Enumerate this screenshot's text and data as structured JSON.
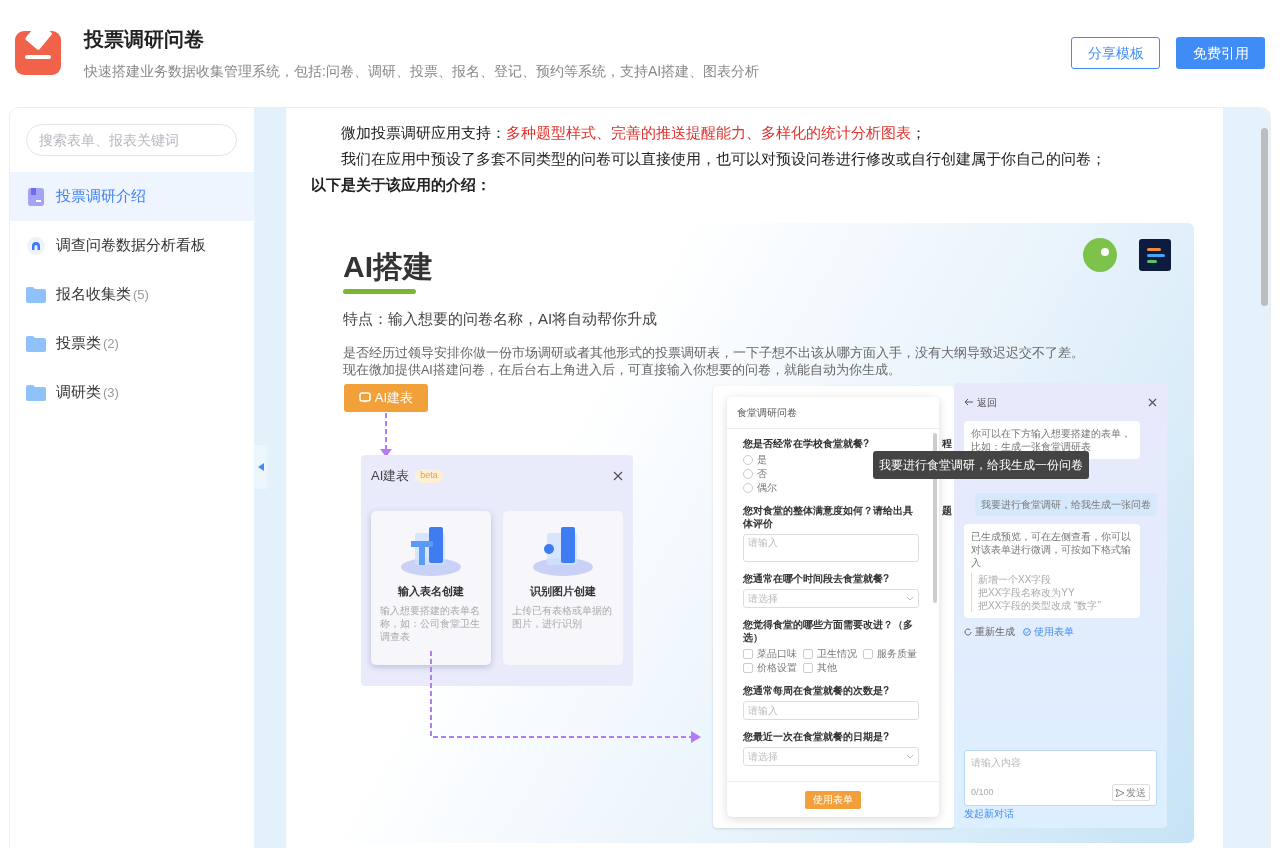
{
  "header": {
    "title": "投票调研问卷",
    "subtitle": "快速搭建业务数据收集管理系统，包括:问卷、调研、投票、报名、登记、预约等系统，支持AI搭建、图表分析",
    "buttons": [
      {
        "label": "分享模板",
        "kind": "outline"
      },
      {
        "label": "免费引用",
        "kind": "primary"
      }
    ]
  },
  "sidebar": {
    "search": {
      "placeholder": "搜索表单、报表关键词"
    },
    "items": [
      {
        "label": "投票调研介绍",
        "kind": "doc",
        "selected": true
      },
      {
        "label": "调查问卷数据分析看板",
        "kind": "dashboard",
        "selected": false
      },
      {
        "label": "报名收集类",
        "count": "(5)",
        "kind": "folder",
        "selected": false
      },
      {
        "label": "投票类",
        "count": "(2)",
        "kind": "folder",
        "selected": false
      },
      {
        "label": "调研类",
        "count": "(3)",
        "kind": "folder",
        "selected": false
      }
    ]
  },
  "content": {
    "paragraphs": [
      {
        "text": "微加投票调研应用支持：",
        "emphasis": "多种题型样式、完善的推送提醒能力、多样化的统计分析图表",
        "tail": "；",
        "indent": true,
        "bold": false
      },
      {
        "text": "我们在应用中预设了多套不同类型的问卷可以直接使用，也可以对预设问卷进行修改或自行创建属于你自己的问卷；",
        "indent": true,
        "bold": false
      },
      {
        "text": "以下是关于该应用的介绍：",
        "indent": false,
        "bold": true
      }
    ],
    "image": {
      "title": "AI搭建",
      "feature": "特点：输入想要的问卷名称，AI将自动帮你升成",
      "description": [
        "是否经历过领导安排你做一份市场调研或者其他形式的投票调研表，一下子想不出该从哪方面入手，没有大纲导致迟迟交不了差。",
        "现在微加提供AI搭建问卷，在后台右上角进入后，可直接输入你想要的问卷，就能自动为你生成。"
      ],
      "ai_button": "AI建表",
      "dialog": {
        "title": "AI建表",
        "badge": "beta",
        "options": [
          {
            "title": "输入表名创建",
            "description": "输入想要搭建的表单名称，如：公司食堂卫生调查表",
            "selected": true
          },
          {
            "title": "识别图片创建",
            "description": "上传已有表格或单据的图片，进行识别",
            "selected": false
          }
        ]
      },
      "background_window": {
        "fragments": [
          "程",
          "题"
        ]
      },
      "form": {
        "title": "食堂调研问卷",
        "questions": [
          {
            "kind": "radio",
            "label": "您是否经常在学校食堂就餐?",
            "options": [
              {
                "label": "是",
                "checked": false
              },
              {
                "label": "否",
                "checked": false
              },
              {
                "label": "偶尔",
                "checked": false
              }
            ]
          },
          {
            "kind": "textarea",
            "label": "您对食堂的整体满意度如何？请给出具体评价",
            "placeholder": "请输入"
          },
          {
            "kind": "select",
            "label": "您通常在哪个时间段去食堂就餐?",
            "placeholder": "请选择"
          },
          {
            "kind": "checkbox",
            "label": "您觉得食堂的哪些方面需要改进？（多选）",
            "options": [
              {
                "label": "菜品口味",
                "checked": false
              },
              {
                "label": "卫生情况",
                "checked": false
              },
              {
                "label": "服务质量",
                "checked": false
              },
              {
                "label": "价格设置",
                "checked": false
              },
              {
                "label": "其他",
                "checked": false
              }
            ]
          },
          {
            "kind": "input",
            "label": "您通常每周在食堂就餐的次数是?",
            "placeholder": "请输入"
          },
          {
            "kind": "select",
            "label": "您最近一次在食堂就餐的日期是?",
            "placeholder": "请选择"
          }
        ],
        "submit": "使用表单"
      },
      "tooltip": "我要进行食堂调研，给我生成一份问卷",
      "chat": {
        "back": "返回",
        "messages": [
          {
            "kind": "assistant",
            "text": "你可以在下方输入想要搭建的表单，比如：生成一张食堂调研表"
          },
          {
            "kind": "user",
            "text": "我要进行食堂调研，给我生成一张问卷"
          },
          {
            "kind": "assistant",
            "text": "已生成预览，可在左侧查看，你可以对该表单进行微调，可按如下格式输入",
            "examples": [
              "新增一个XX字段",
              "把XX字段名称改为YY",
              "把XX字段的类型改成 “数字”"
            ]
          }
        ],
        "actions": [
          {
            "label": "重新生成",
            "kind": "refresh"
          },
          {
            "label": "使用表单",
            "kind": "confirm"
          }
        ],
        "input": {
          "placeholder": "请输入内容",
          "counter": "0/100",
          "send": "发送"
        },
        "new_chat": "发起新对话"
      }
    }
  }
}
